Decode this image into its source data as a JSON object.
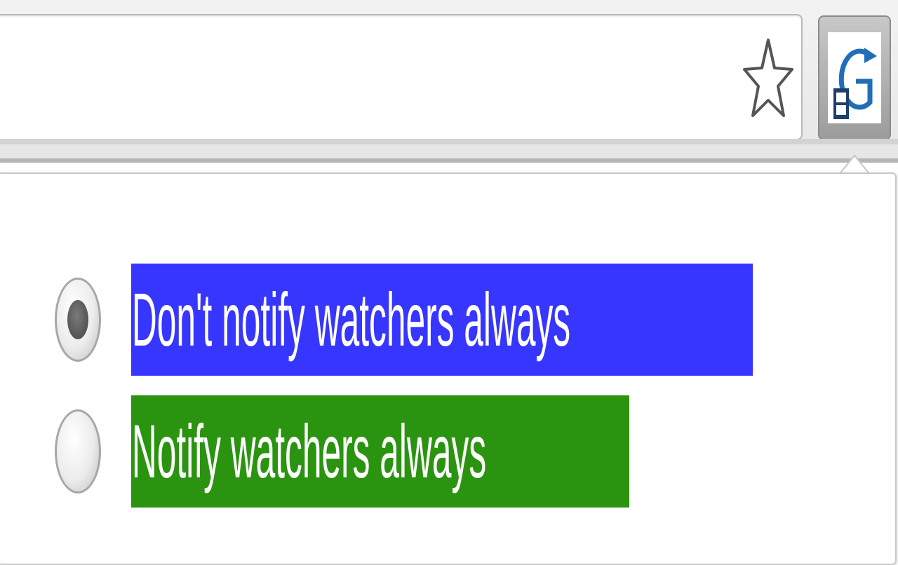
{
  "toolbar": {
    "star_icon": "star-outline-icon",
    "extension_icon": "g-refresh-icon"
  },
  "popup": {
    "options": [
      {
        "label": "Don't notify watchers always",
        "selected": true,
        "background": "#3636ff"
      },
      {
        "label": "Notify watchers always",
        "selected": false,
        "background": "#2a9410"
      }
    ]
  }
}
